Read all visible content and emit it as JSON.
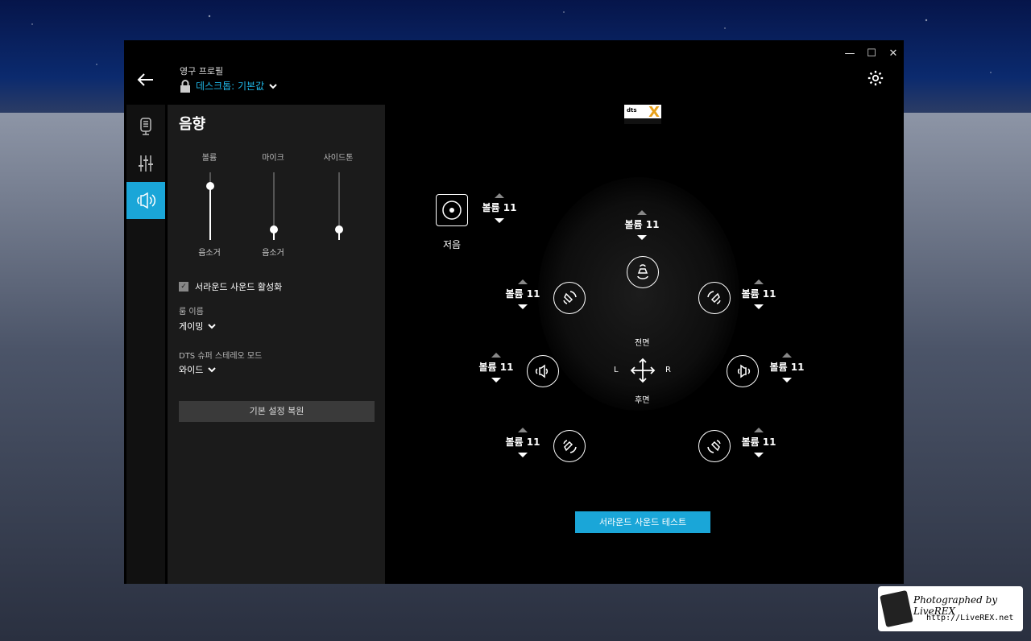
{
  "profile": {
    "label": "영구 프로필",
    "name": "데스크톱: 기본값"
  },
  "panel": {
    "title": "음향",
    "sliders": [
      {
        "label": "볼륨",
        "caption": "음소거",
        "level": 0.8
      },
      {
        "label": "마이크",
        "caption": "음소거",
        "level": 0.15
      },
      {
        "label": "사이드톤",
        "caption": "",
        "level": 0.15
      }
    ],
    "surround_check": "서라운드 사운드 활성화",
    "room_label": "룸 이름",
    "room_value": "게이밍",
    "dts_label": "DTS 슈퍼 스테레오 모드",
    "dts_value": "와이드",
    "reset_button": "기본 설정 복원"
  },
  "main": {
    "sub_label": "저음",
    "volume_text": "볼륨 11",
    "front_label": "전면",
    "rear_label": "후면",
    "left_label": "L",
    "right_label": "R",
    "test_button": "서라운드 사운드 테스트"
  },
  "titlebar": {
    "minimize": "—",
    "maximize": "☐",
    "close": "✕"
  },
  "watermark": {
    "line1": "Photographed by LiveREX",
    "line2": "http://LiveREX.net"
  },
  "colors": {
    "accent": "#1aa6d8"
  }
}
